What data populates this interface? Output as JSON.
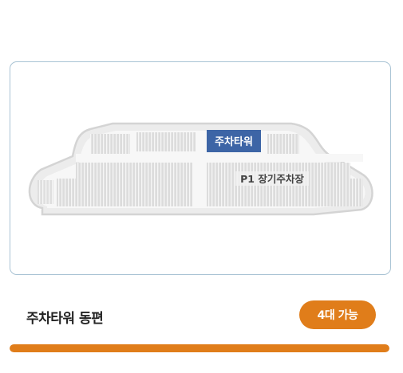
{
  "map": {
    "highlight_label": "주차타워",
    "lot_label": "P1 장기주차장",
    "highlight_color": "#3d65a6"
  },
  "location": {
    "title": "주차타워 동편",
    "availability": "4대 가능",
    "accent_color": "#e07d1a",
    "fill_percent": 100
  }
}
